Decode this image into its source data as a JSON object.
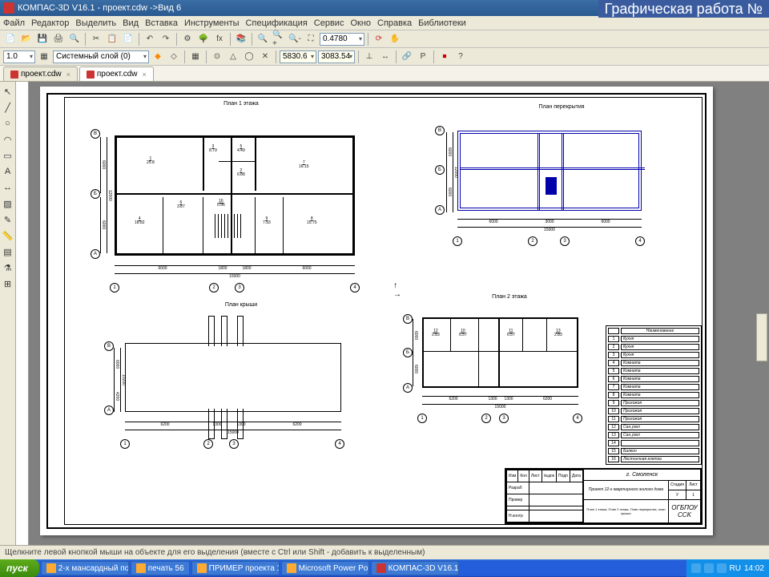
{
  "banner": "Графическая работа №",
  "window": {
    "title": "КОМПАС-3D V16.1 - проект.cdw ->Вид 6"
  },
  "menu": [
    "Файл",
    "Редактор",
    "Выделить",
    "Вид",
    "Вставка",
    "Инструменты",
    "Спецификация",
    "Сервис",
    "Окно",
    "Справка",
    "Библиотеки"
  ],
  "toolbar2": {
    "scale": "1.0",
    "layer": "Системный слой (0)",
    "coord_x": "5830.6",
    "coord_y": "3083.54",
    "zoom": "0.4780"
  },
  "tabs": [
    {
      "label": "проект.cdw",
      "active": false
    },
    {
      "label": "проект.cdw",
      "active": true
    }
  ],
  "drawings": {
    "plan1": {
      "title": "План 1 этажа",
      "dim_bottom_total": "15000",
      "dim_bottom_left": "6000",
      "dim_bottom_mid": "1800",
      "dim_bottom_mid2": "1800",
      "dim_bottom_right": "6000",
      "dim_left_total": "12000",
      "dim_left_top": "6000",
      "dim_left_bot": "6000",
      "axes_h": [
        "1",
        "2",
        "3",
        "4"
      ],
      "axes_v": [
        "А",
        "Б",
        "В"
      ],
      "rooms": [
        {
          "n": "1",
          "s": "25.8"
        },
        {
          "n": "3",
          "s": "8.79"
        },
        {
          "n": "5",
          "s": "4.49"
        },
        {
          "n": "2",
          "s": "6.88"
        },
        {
          "n": "7",
          "s": "16.15"
        },
        {
          "n": "4",
          "s": "18.82"
        },
        {
          "n": "6",
          "s": "3.87"
        },
        {
          "n": "16",
          "s": "6.96"
        },
        {
          "n": "8",
          "s": "15.75"
        },
        {
          "n": "9",
          "s": "7.93"
        }
      ]
    },
    "roof": {
      "title": "План крыши",
      "dim_total": "15000",
      "dim1": "6200",
      "dim2": "1300",
      "dim3": "1300",
      "dim4": "6200",
      "dim_v": "10200",
      "dim_v1": "6000",
      "dim_v2": "4200",
      "axes": [
        "А",
        "В",
        "1",
        "2",
        "3",
        "4"
      ]
    },
    "ceiling": {
      "title": "План перекрытия",
      "dim_total": "15000",
      "dim1": "6000",
      "dim2": "3000",
      "dim3": "6000",
      "dim_v": "12000",
      "dim_v1": "6000",
      "axes_h": [
        "1",
        "2",
        "3",
        "4"
      ],
      "axes_v": [
        "А",
        "Б",
        "В"
      ]
    },
    "plan2": {
      "title": "План 2 этажа",
      "dim_total": "15000",
      "dim1": "6200",
      "dim2": "1300",
      "dim3": "1300",
      "dim4": "6200",
      "dim_v": "6000",
      "dim_v2": "6000",
      "axes_h": [
        "1",
        "2",
        "3",
        "4"
      ],
      "axes_v": [
        "А",
        "Б",
        "В"
      ]
    }
  },
  "rooms_list": {
    "header": "Наименование",
    "rows": [
      {
        "n": "1",
        "name": "Кухня"
      },
      {
        "n": "2",
        "name": "Кухня"
      },
      {
        "n": "3",
        "name": "Кухня"
      },
      {
        "n": "4",
        "name": "Комната"
      },
      {
        "n": "5",
        "name": "Комната"
      },
      {
        "n": "6",
        "name": "Комната"
      },
      {
        "n": "7",
        "name": "Комната"
      },
      {
        "n": "8",
        "name": "Комната"
      },
      {
        "n": "9",
        "name": "Прихожая"
      },
      {
        "n": "10",
        "name": "Прихожая"
      },
      {
        "n": "11",
        "name": "Прихожая"
      },
      {
        "n": "12",
        "name": "Сан.узел"
      },
      {
        "n": "13",
        "name": "Сан.узел"
      },
      {
        "n": "14",
        "name": ""
      },
      {
        "n": "15",
        "name": "Балкон"
      },
      {
        "n": "16",
        "name": "Лестничная клетка"
      }
    ]
  },
  "stamp": {
    "city": "г. Смоленск",
    "project": "Проект 12-х квартирного жилого дома",
    "sheet": "План 1 этажа, План 2 этажа, План перекрытия, план крыши",
    "org": "ОГБПОУ СCK",
    "stage": "У",
    "sheet_n": "1",
    "sheets": "1",
    "row_labels": [
      "Изм",
      "Кол",
      "Лист",
      "№док",
      "Подп",
      "Дата"
    ],
    "role1": "Разраб",
    "role2": "Провер",
    "role3": "Н.контр"
  },
  "status": "Щелкните левой кнопкой мыши на объекте для его выделения (вместе с Ctrl или Shift - добавить к выделенным)",
  "taskbar": {
    "start": "пуск",
    "tasks": [
      "2-х мансардный по...",
      "печать 56",
      "ПРИМЕР проекта 12-...",
      "Microsoft Power Point ...",
      "КОМПАС-3D V16.1 ..."
    ],
    "lang": "RU",
    "clock": "14:02"
  }
}
